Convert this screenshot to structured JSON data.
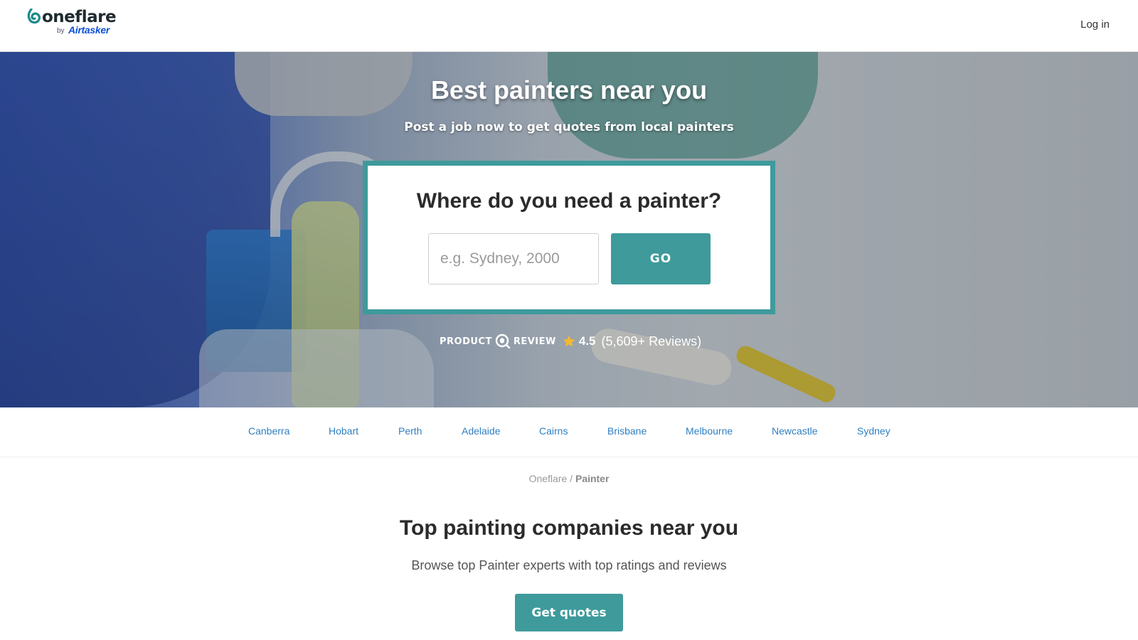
{
  "header": {
    "logo_text": "oneflare",
    "logo_by": "by",
    "logo_partner": "Airtasker",
    "login_label": "Log in"
  },
  "hero": {
    "title": "Best painters near you",
    "subtitle": "Post a job now to get quotes from local painters",
    "search": {
      "heading": "Where do you need a painter?",
      "placeholder": "e.g. Sydney, 2000",
      "value": "",
      "go_label": "GO"
    },
    "review": {
      "product_label": "PRODUCT",
      "review_label": "REVIEW",
      "rating": "4.5",
      "count": "(5,609+ Reviews)",
      "star_color": "#f5b82e"
    }
  },
  "cities": [
    "Canberra",
    "Hobart",
    "Perth",
    "Adelaide",
    "Cairns",
    "Brisbane",
    "Melbourne",
    "Newcastle",
    "Sydney"
  ],
  "breadcrumb": {
    "home": "Oneflare",
    "separator": " / ",
    "current": "Painter"
  },
  "section": {
    "title": "Top painting companies near you",
    "subtitle": "Browse top Painter experts with top ratings and reviews",
    "cta_label": "Get quotes"
  },
  "colors": {
    "accent": "#3f9a9b",
    "link": "#2f7fc1",
    "airtasker_blue": "#0a4fd6"
  }
}
